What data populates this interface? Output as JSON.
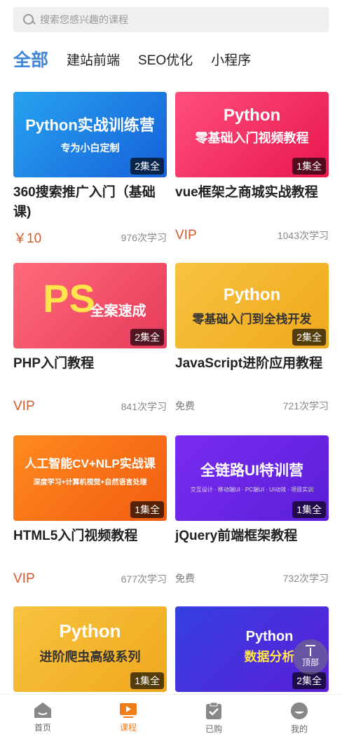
{
  "search": {
    "placeholder": "搜索您感兴趣的课程"
  },
  "tabs": [
    {
      "label": "全部"
    },
    {
      "label": "建站前端"
    },
    {
      "label": "SEO优化"
    },
    {
      "label": "小程序"
    }
  ],
  "courses": [
    {
      "thumb_title": "Python实战训练营",
      "thumb_sub": "专为小白定制",
      "episodes": "2集全",
      "title": "360搜索推广入门（基础课)",
      "price": "￥10",
      "learners": "976次学习"
    },
    {
      "thumb_title": "Python",
      "thumb_sub": "零基础入门视频教程",
      "episodes": "1集全",
      "title": "vue框架之商城实战教程",
      "price": "VIP",
      "learners": "1043次学习"
    },
    {
      "thumb_title": "PS",
      "thumb_sub": "全案速成",
      "episodes": "2集全",
      "title": "PHP入门教程",
      "price": "VIP",
      "learners": "841次学习"
    },
    {
      "thumb_title": "Python",
      "thumb_sub": "零基础入门到全栈开发",
      "episodes": "2集全",
      "title": "JavaScript进阶应用教程",
      "price": "免费",
      "learners": "721次学习"
    },
    {
      "thumb_title": "人工智能CV+NLP实战课",
      "thumb_sub": "深度学习+计算机视觉+自然语言处理",
      "episodes": "1集全",
      "title": "HTML5入门视频教程",
      "price": "VIP",
      "learners": "677次学习"
    },
    {
      "thumb_title": "全链路UI特训营",
      "thumb_sub": "交互设计 · 移动端UI · PC端UI · UI动效 · 项目实训",
      "episodes": "1集全",
      "title": "jQuery前端框架教程",
      "price": "免费",
      "learners": "732次学习"
    },
    {
      "thumb_title": "Python",
      "thumb_sub": "进阶爬虫高级系列",
      "episodes": "1集全",
      "title": "",
      "price": "",
      "learners": ""
    },
    {
      "thumb_title": "Python",
      "thumb_sub": "数据分析",
      "episodes": "2集全",
      "title": "",
      "price": "",
      "learners": ""
    }
  ],
  "back_to_top": {
    "label": "顶部"
  },
  "tabbar": [
    {
      "label": "首页",
      "icon": "home-icon"
    },
    {
      "label": "课程",
      "icon": "course-icon"
    },
    {
      "label": "已购",
      "icon": "purchased-icon"
    },
    {
      "label": "我的",
      "icon": "profile-icon"
    }
  ],
  "colors": {
    "accent": "#3f86d8",
    "price": "#d45a2a",
    "tabbar_active": "#f07d1a"
  }
}
